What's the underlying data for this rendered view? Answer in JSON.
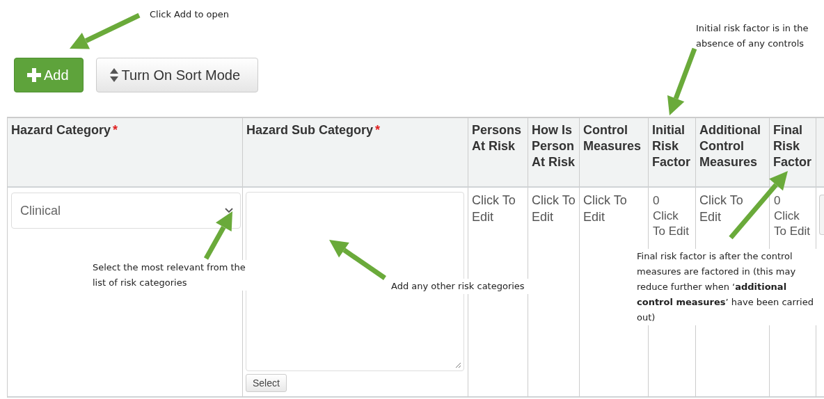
{
  "toolbar": {
    "buttons": [
      {
        "kind": "primary",
        "label": "Add"
      },
      {
        "kind": "sort",
        "label": "Turn On Sort Mode"
      }
    ]
  },
  "table": {
    "columns": [
      {
        "label": "Hazard Category",
        "required_mark": "*"
      },
      {
        "label": "Hazard Sub Category",
        "required_mark": "*"
      },
      {
        "label": "Persons At Risk"
      },
      {
        "label": "How Is Person At Risk"
      },
      {
        "label": "Control Measures"
      },
      {
        "label": "Initial Risk Factor"
      },
      {
        "label": "Additional Control Measures"
      },
      {
        "label": "Final Risk Factor"
      }
    ],
    "rows": [
      {
        "cells": [
          {
            "kind": "select",
            "value": "Clinical"
          },
          {
            "kind": "textarea",
            "button": "Select"
          },
          {
            "kind": "link",
            "text": "Click To Edit"
          },
          {
            "kind": "link",
            "text": "Click To Edit"
          },
          {
            "kind": "link",
            "text": "Click To Edit"
          },
          {
            "kind": "score",
            "value": "0",
            "text": "Click To Edit"
          },
          {
            "kind": "link",
            "text": "Click To Edit"
          },
          {
            "kind": "score",
            "value": "0",
            "text": "Click To Edit"
          }
        ]
      }
    ]
  },
  "annotations": [
    {
      "text": "Click Add to open"
    },
    {
      "text": "Initial risk factor is in the absence of any controls"
    },
    {
      "text": "Select the most relevant from the list of risk categories"
    },
    {
      "text": "Add any other risk categories"
    },
    {
      "text": "Final risk factor is after the control measures are factored in (this may reduce further when ‘**additional control measures**’ have been carried out)"
    }
  ]
}
